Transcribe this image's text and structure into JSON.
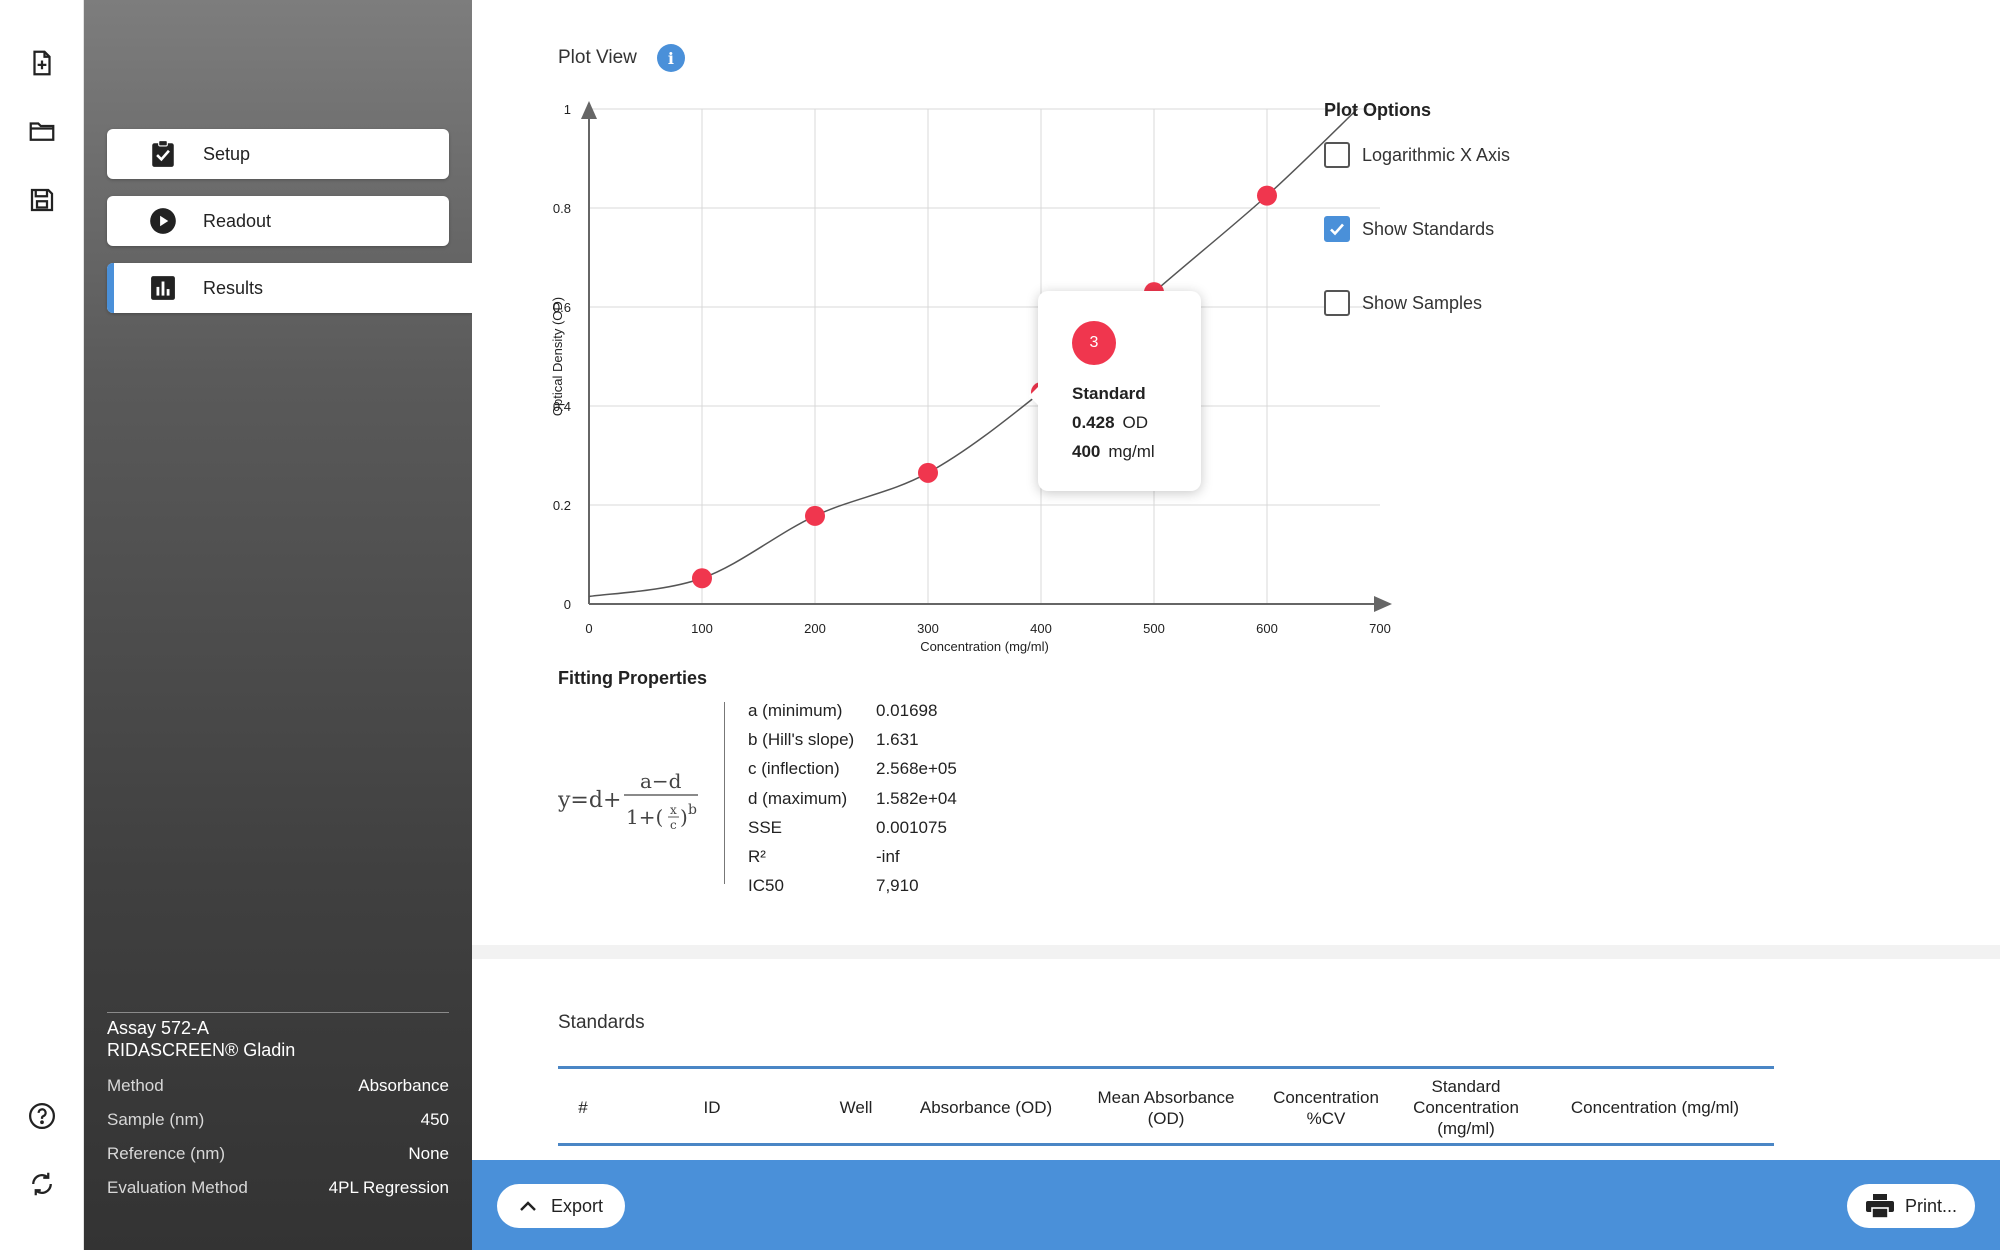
{
  "rail": {
    "icons": [
      "new-file-icon",
      "folder-icon",
      "save-icon",
      "help-icon",
      "sync-icon"
    ]
  },
  "sidebar": {
    "nav": [
      {
        "label": "Setup",
        "icon": "clipboard-check-icon"
      },
      {
        "label": "Readout",
        "icon": "play-circle-icon"
      },
      {
        "label": "Results",
        "icon": "bar-chart-icon",
        "active": true
      }
    ],
    "assay": {
      "name": "Assay 572-A",
      "kit": "RIDASCREEN® Gladin",
      "rows": [
        {
          "label": "Method",
          "value": "Absorbance"
        },
        {
          "label": "Sample (nm)",
          "value": "450"
        },
        {
          "label": "Reference (nm)",
          "value": "None"
        },
        {
          "label": "Evaluation Method",
          "value": "4PL Regression"
        }
      ]
    }
  },
  "plot": {
    "title": "Plot View",
    "info_icon": "i"
  },
  "chart_data": {
    "type": "scatter",
    "xlabel": "Concentration (mg/ml)",
    "ylabel": "Optical Density (OD)",
    "xlim": [
      0,
      700
    ],
    "ylim": [
      0,
      1
    ],
    "x_ticks": [
      "0",
      "100",
      "200",
      "300",
      "400",
      "500",
      "600",
      "700"
    ],
    "y_ticks": [
      "0",
      "0.2",
      "0.4",
      "0.6",
      "0.8",
      "1"
    ],
    "grid": true,
    "series": [
      {
        "points": [
          {
            "x": 100,
            "y": 0.052
          },
          {
            "x": 200,
            "y": 0.178
          },
          {
            "x": 300,
            "y": 0.265
          },
          {
            "x": 400,
            "y": 0.428
          },
          {
            "x": 500,
            "y": 0.63
          },
          {
            "x": 600,
            "y": 0.825
          }
        ],
        "color": "#f0364e"
      }
    ],
    "fit_curve": {
      "type": "4PL",
      "a": 0.01698,
      "b": 1.631,
      "c": 256800,
      "d": 15820,
      "color": "#555555"
    }
  },
  "tooltip": {
    "badge": "3",
    "title": "Standard",
    "od_value": "0.428",
    "od_unit": "OD",
    "conc_value": "400",
    "conc_unit": "mg/ml"
  },
  "plot_options": {
    "title": "Plot Options",
    "options": [
      {
        "label": "Logarithmic X Axis",
        "checked": false
      },
      {
        "label": "Show Standards",
        "checked": true
      },
      {
        "label": "Show Samples",
        "checked": false
      }
    ]
  },
  "fitting": {
    "title": "Fitting Properties",
    "params": [
      {
        "key": "a (minimum)",
        "value": "0.01698"
      },
      {
        "key": "b (Hill's slope)",
        "value": "1.631"
      },
      {
        "key": "c (inflection)",
        "value": "2.568e+05"
      },
      {
        "key": "d (maximum)",
        "value": "1.582e+04"
      },
      {
        "key": "SSE",
        "value": "0.001075"
      },
      {
        "key": "R²",
        "value": "-inf"
      },
      {
        "key": "IC50",
        "value": "7,910"
      }
    ]
  },
  "standards": {
    "title": "Standards",
    "headers": [
      "#",
      "ID",
      "Well",
      "Absorbance (OD)",
      "Mean Absorbance (OD)",
      "Concentration %CV",
      "Standard Concentration (mg/ml)",
      "Concentration (mg/ml)"
    ]
  },
  "bottom_bar": {
    "export_label": "Export",
    "print_label": "Print..."
  },
  "colors": {
    "accent": "#4a90d9",
    "point": "#f0364e",
    "table_rule": "#4a86c5"
  }
}
